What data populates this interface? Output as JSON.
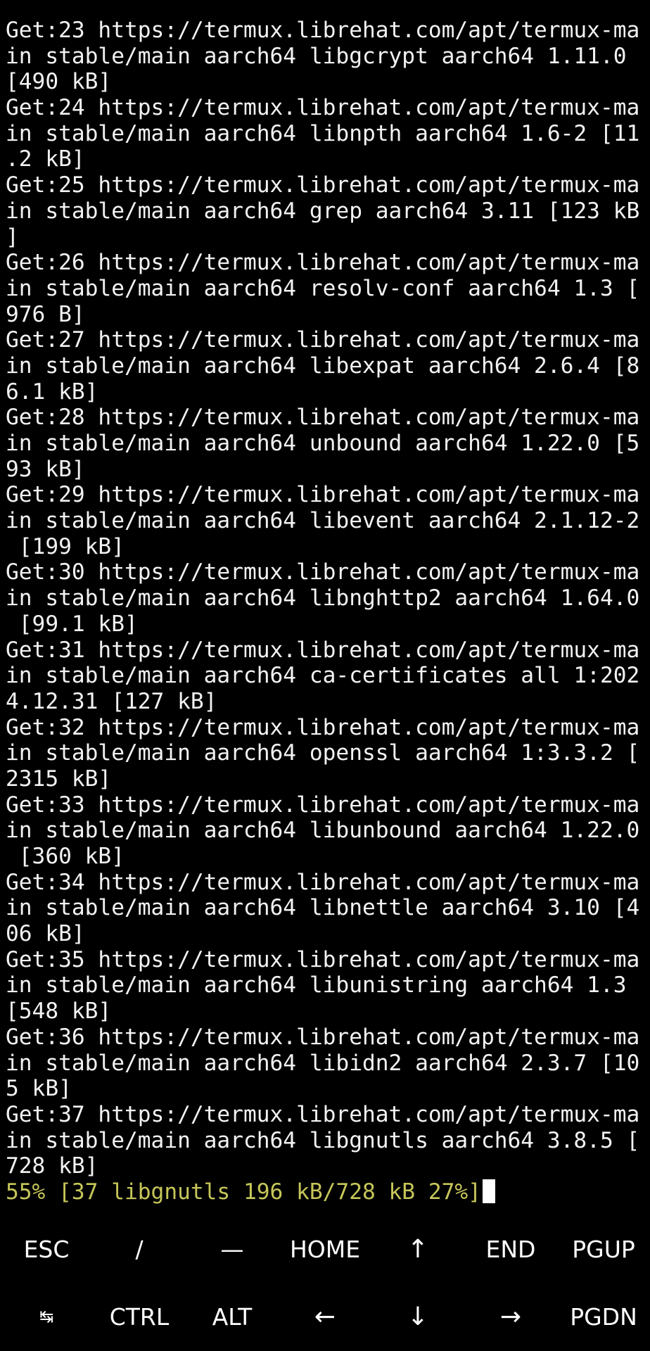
{
  "terminal": {
    "lines": [
      "Get:23 https://termux.librehat.com/apt/termux-ma",
      "in stable/main aarch64 libgcrypt aarch64 1.11.0",
      "[490 kB]",
      "Get:24 https://termux.librehat.com/apt/termux-ma",
      "in stable/main aarch64 libnpth aarch64 1.6-2 [11",
      ".2 kB]",
      "Get:25 https://termux.librehat.com/apt/termux-ma",
      "in stable/main aarch64 grep aarch64 3.11 [123 kB",
      "]",
      "Get:26 https://termux.librehat.com/apt/termux-ma",
      "in stable/main aarch64 resolv-conf aarch64 1.3 [",
      "976 B]",
      "Get:27 https://termux.librehat.com/apt/termux-ma",
      "in stable/main aarch64 libexpat aarch64 2.6.4 [8",
      "6.1 kB]",
      "Get:28 https://termux.librehat.com/apt/termux-ma",
      "in stable/main aarch64 unbound aarch64 1.22.0 [5",
      "93 kB]",
      "Get:29 https://termux.librehat.com/apt/termux-ma",
      "in stable/main aarch64 libevent aarch64 2.1.12-2",
      " [199 kB]",
      "Get:30 https://termux.librehat.com/apt/termux-ma",
      "in stable/main aarch64 libnghttp2 aarch64 1.64.0",
      " [99.1 kB]",
      "Get:31 https://termux.librehat.com/apt/termux-ma",
      "in stable/main aarch64 ca-certificates all 1:202",
      "4.12.31 [127 kB]",
      "Get:32 https://termux.librehat.com/apt/termux-ma",
      "in stable/main aarch64 openssl aarch64 1:3.3.2 [",
      "2315 kB]",
      "Get:33 https://termux.librehat.com/apt/termux-ma",
      "in stable/main aarch64 libunbound aarch64 1.22.0",
      " [360 kB]",
      "Get:34 https://termux.librehat.com/apt/termux-ma",
      "in stable/main aarch64 libnettle aarch64 3.10 [4",
      "06 kB]",
      "Get:35 https://termux.librehat.com/apt/termux-ma",
      "in stable/main aarch64 libunistring aarch64 1.3",
      "[548 kB]",
      "Get:36 https://termux.librehat.com/apt/termux-ma",
      "in stable/main aarch64 libidn2 aarch64 2.3.7 [10",
      "5 kB]",
      "Get:37 https://termux.librehat.com/apt/termux-ma",
      "in stable/main aarch64 libgnutls aarch64 3.8.5 [",
      "728 kB]"
    ],
    "progress_line": "55% [37 libgnutls 196 kB/728 kB 27%]",
    "colors": {
      "background": "#000000",
      "text": "#f2f2f2",
      "progress_text": "#c6c65a",
      "cursor": "#ffffff"
    }
  },
  "extra_keys": {
    "row1": [
      {
        "name": "key-esc",
        "label": "ESC"
      },
      {
        "name": "key-slash",
        "label": "/"
      },
      {
        "name": "key-dash",
        "label": "—"
      },
      {
        "name": "key-home",
        "label": "HOME"
      },
      {
        "name": "key-up-arrow",
        "label": "↑",
        "icon": "arrow-up-icon"
      },
      {
        "name": "key-end",
        "label": "END"
      },
      {
        "name": "key-pgup",
        "label": "PGUP"
      }
    ],
    "row2": [
      {
        "name": "key-tab",
        "label": "↹",
        "icon": "tab-icon"
      },
      {
        "name": "key-ctrl",
        "label": "CTRL"
      },
      {
        "name": "key-alt",
        "label": "ALT"
      },
      {
        "name": "key-left-arrow",
        "label": "←",
        "icon": "arrow-left-icon"
      },
      {
        "name": "key-down-arrow",
        "label": "↓",
        "icon": "arrow-down-icon"
      },
      {
        "name": "key-right-arrow",
        "label": "→",
        "icon": "arrow-right-icon"
      },
      {
        "name": "key-pgdn",
        "label": "PGDN"
      }
    ]
  }
}
